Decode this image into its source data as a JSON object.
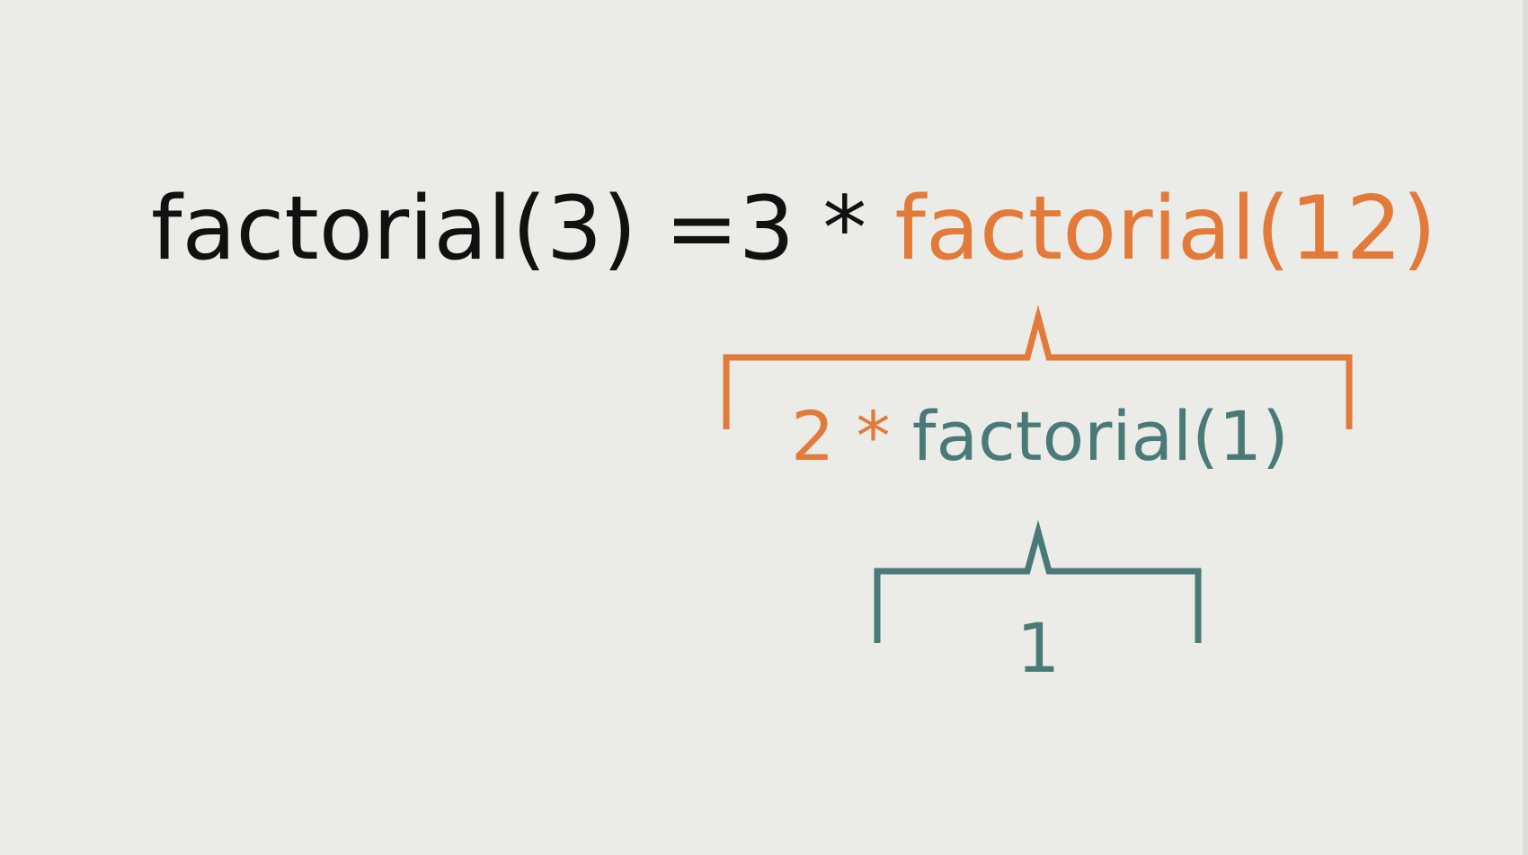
{
  "colors": {
    "background": "#ebebe7",
    "black": "#111111",
    "orange": "#e27a3a",
    "teal": "#4a7a78"
  },
  "expression": {
    "lhs": "factorial(3)",
    "equals": " =",
    "three": "3",
    "times": " * ",
    "call": "factorial(12)"
  },
  "level2": {
    "two": "2",
    "times": " * ",
    "call": "factorial(1)"
  },
  "level3": {
    "value": "1"
  }
}
